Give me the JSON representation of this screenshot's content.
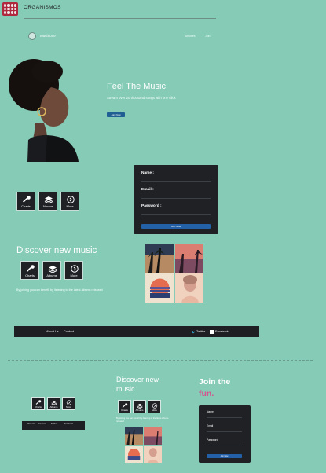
{
  "header": {
    "title": "ORGANISMOS"
  },
  "nav": {
    "brand": "Touchtone",
    "links": [
      "Albumes",
      "Join"
    ]
  },
  "hero": {
    "title": "Feel The Music",
    "text": "Stream over 20 thousand songs with one click",
    "button_label": "Join Now"
  },
  "form": {
    "fields": [
      "Name :",
      "Email :",
      "Password :"
    ],
    "button_label": "Join Now"
  },
  "icons": [
    {
      "label": "Charts",
      "icon": "microphone-icon"
    },
    {
      "label": "Albums",
      "icon": "layers-icon"
    },
    {
      "label": "More",
      "icon": "chevron-right-circle-icon"
    }
  ],
  "discover": {
    "title": "Discover new music",
    "text": "By joining you can benefit by listening to the latest albums released"
  },
  "footer": {
    "links": [
      "About Us",
      "Contact"
    ],
    "social": [
      "Twitter",
      "Facebook"
    ]
  },
  "mini_footer": {
    "links": [
      "About Us",
      "Contact",
      "Twitter",
      "Facebook"
    ]
  },
  "join": {
    "line1": "Join the",
    "line2": "fun."
  },
  "small_form": {
    "fields": [
      "Name",
      "Email",
      "Password"
    ],
    "button_label": "Join Now"
  },
  "colors": {
    "background": "#86cbb6",
    "card": "#1f2125",
    "button": "#2460a7",
    "accent": "#d4548e"
  }
}
